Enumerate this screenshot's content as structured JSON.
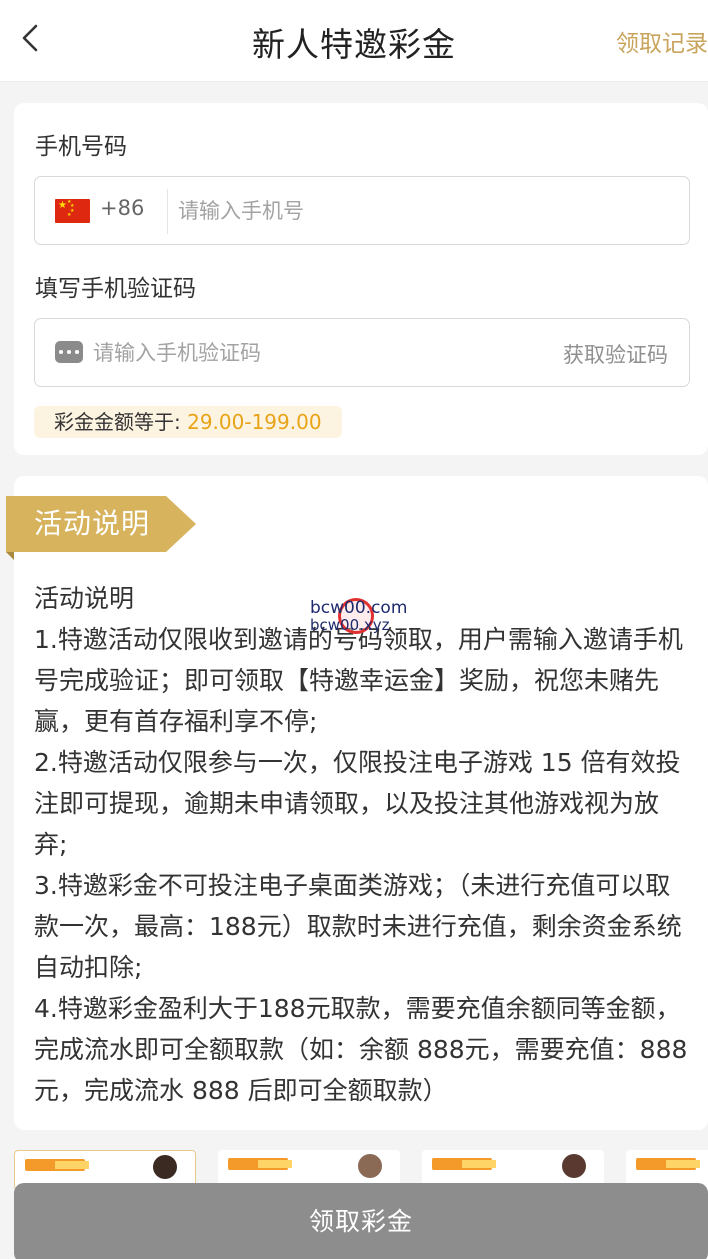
{
  "header": {
    "title": "新人特邀彩金",
    "record_link": "领取记录"
  },
  "form": {
    "phone_label": "手机号码",
    "country_code": "+86",
    "phone_placeholder": "请输入手机号",
    "code_label": "填写手机验证码",
    "code_placeholder": "请输入手机验证码",
    "get_code_button": "获取验证码",
    "amount_label": "彩金金额等于:",
    "amount_value": "29.00-199.00"
  },
  "description": {
    "ribbon_title": "活动说明",
    "heading": "活动说明",
    "items": [
      "1.特邀活动仅限收到邀请的号码领取，用户需输入邀请手机号完成验证；即可领取【特邀幸运金】奖励，祝您未赌先赢，更有首存福利享不停;",
      "2.特邀活动仅限参与一次，仅限投注电子游戏 15 倍有效投注即可提现，逾期未申请领取，以及投注其他游戏视为放弃;",
      "3.特邀彩金不可投注电子桌面类游戏；（未进行充值可以取款一次，最高：188元）取款时未进行充值，剩余资金系统自动扣除;",
      "4.特邀彩金盈利大于188元取款，需要充值余额同等金额，完成流水即可全额取款（如：余额 888元，需要充值：888元，完成流水 888 后即可全额取款）"
    ]
  },
  "watermark": {
    "line1": "bcw00.com",
    "line2": "bcw00.xyz"
  },
  "claim_button": "领取彩金",
  "colors": {
    "accent_gold": "#c9a45c",
    "ribbon": "#d6b35c",
    "amount_value": "#e8a317",
    "button_disabled": "#8d8d8d"
  }
}
